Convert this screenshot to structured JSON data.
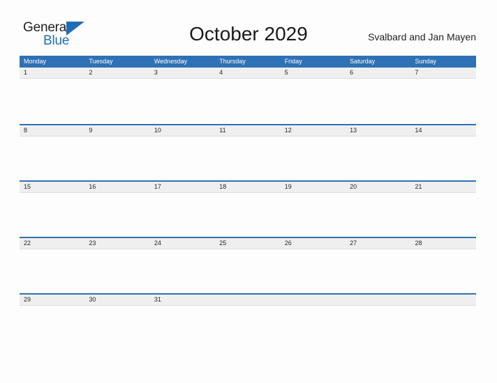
{
  "brand": {
    "name_part1": "General",
    "name_part2": "Blue",
    "triangle_icon": "triangle-icon",
    "primary_color": "#2e71b4"
  },
  "header": {
    "title": "October 2029",
    "region": "Svalbard and Jan Mayen"
  },
  "calendar": {
    "weekdays": [
      "Monday",
      "Tuesday",
      "Wednesday",
      "Thursday",
      "Friday",
      "Saturday",
      "Sunday"
    ],
    "header_bg": "#2e71b4",
    "date_band_bg": "#efefef",
    "weeks": [
      {
        "days": [
          "1",
          "2",
          "3",
          "4",
          "5",
          "6",
          "7"
        ]
      },
      {
        "days": [
          "8",
          "9",
          "10",
          "11",
          "12",
          "13",
          "14"
        ]
      },
      {
        "days": [
          "15",
          "16",
          "17",
          "18",
          "19",
          "20",
          "21"
        ]
      },
      {
        "days": [
          "22",
          "23",
          "24",
          "25",
          "26",
          "27",
          "28"
        ]
      },
      {
        "days": [
          "29",
          "30",
          "31",
          "",
          "",
          "",
          ""
        ]
      }
    ]
  }
}
